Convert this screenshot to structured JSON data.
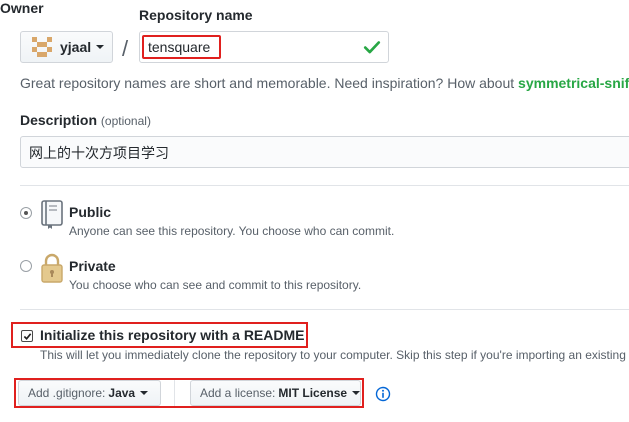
{
  "owner": {
    "label": "Owner",
    "name": "yjaal"
  },
  "repository": {
    "label": "Repository name",
    "value": "tensquare",
    "valid_icon": "check-icon"
  },
  "hint": {
    "text": "Great repository names are short and memorable. Need inspiration? How about ",
    "suggestion": "symmetrical-sniffl"
  },
  "description": {
    "label": "Description",
    "optional": "(optional)",
    "value": "网上的十次方项目学习"
  },
  "visibility": {
    "public": {
      "title": "Public",
      "note": "Anyone can see this repository. You choose who can commit.",
      "selected": true,
      "icon": "repo-book-icon"
    },
    "private": {
      "title": "Private",
      "note": "You choose who can see and commit to this repository.",
      "selected": false,
      "icon": "lock-icon"
    }
  },
  "readme": {
    "title": "Initialize this repository with a README",
    "note": "This will let you immediately clone the repository to your computer. Skip this step if you're importing an existing",
    "checked": true
  },
  "gitignore": {
    "label": "Add .gitignore:",
    "value": "Java"
  },
  "license": {
    "label": "Add a license:",
    "value": "MIT License"
  },
  "colors": {
    "highlight": "#e0201e",
    "success": "#28a745",
    "link": "#0366d6"
  }
}
